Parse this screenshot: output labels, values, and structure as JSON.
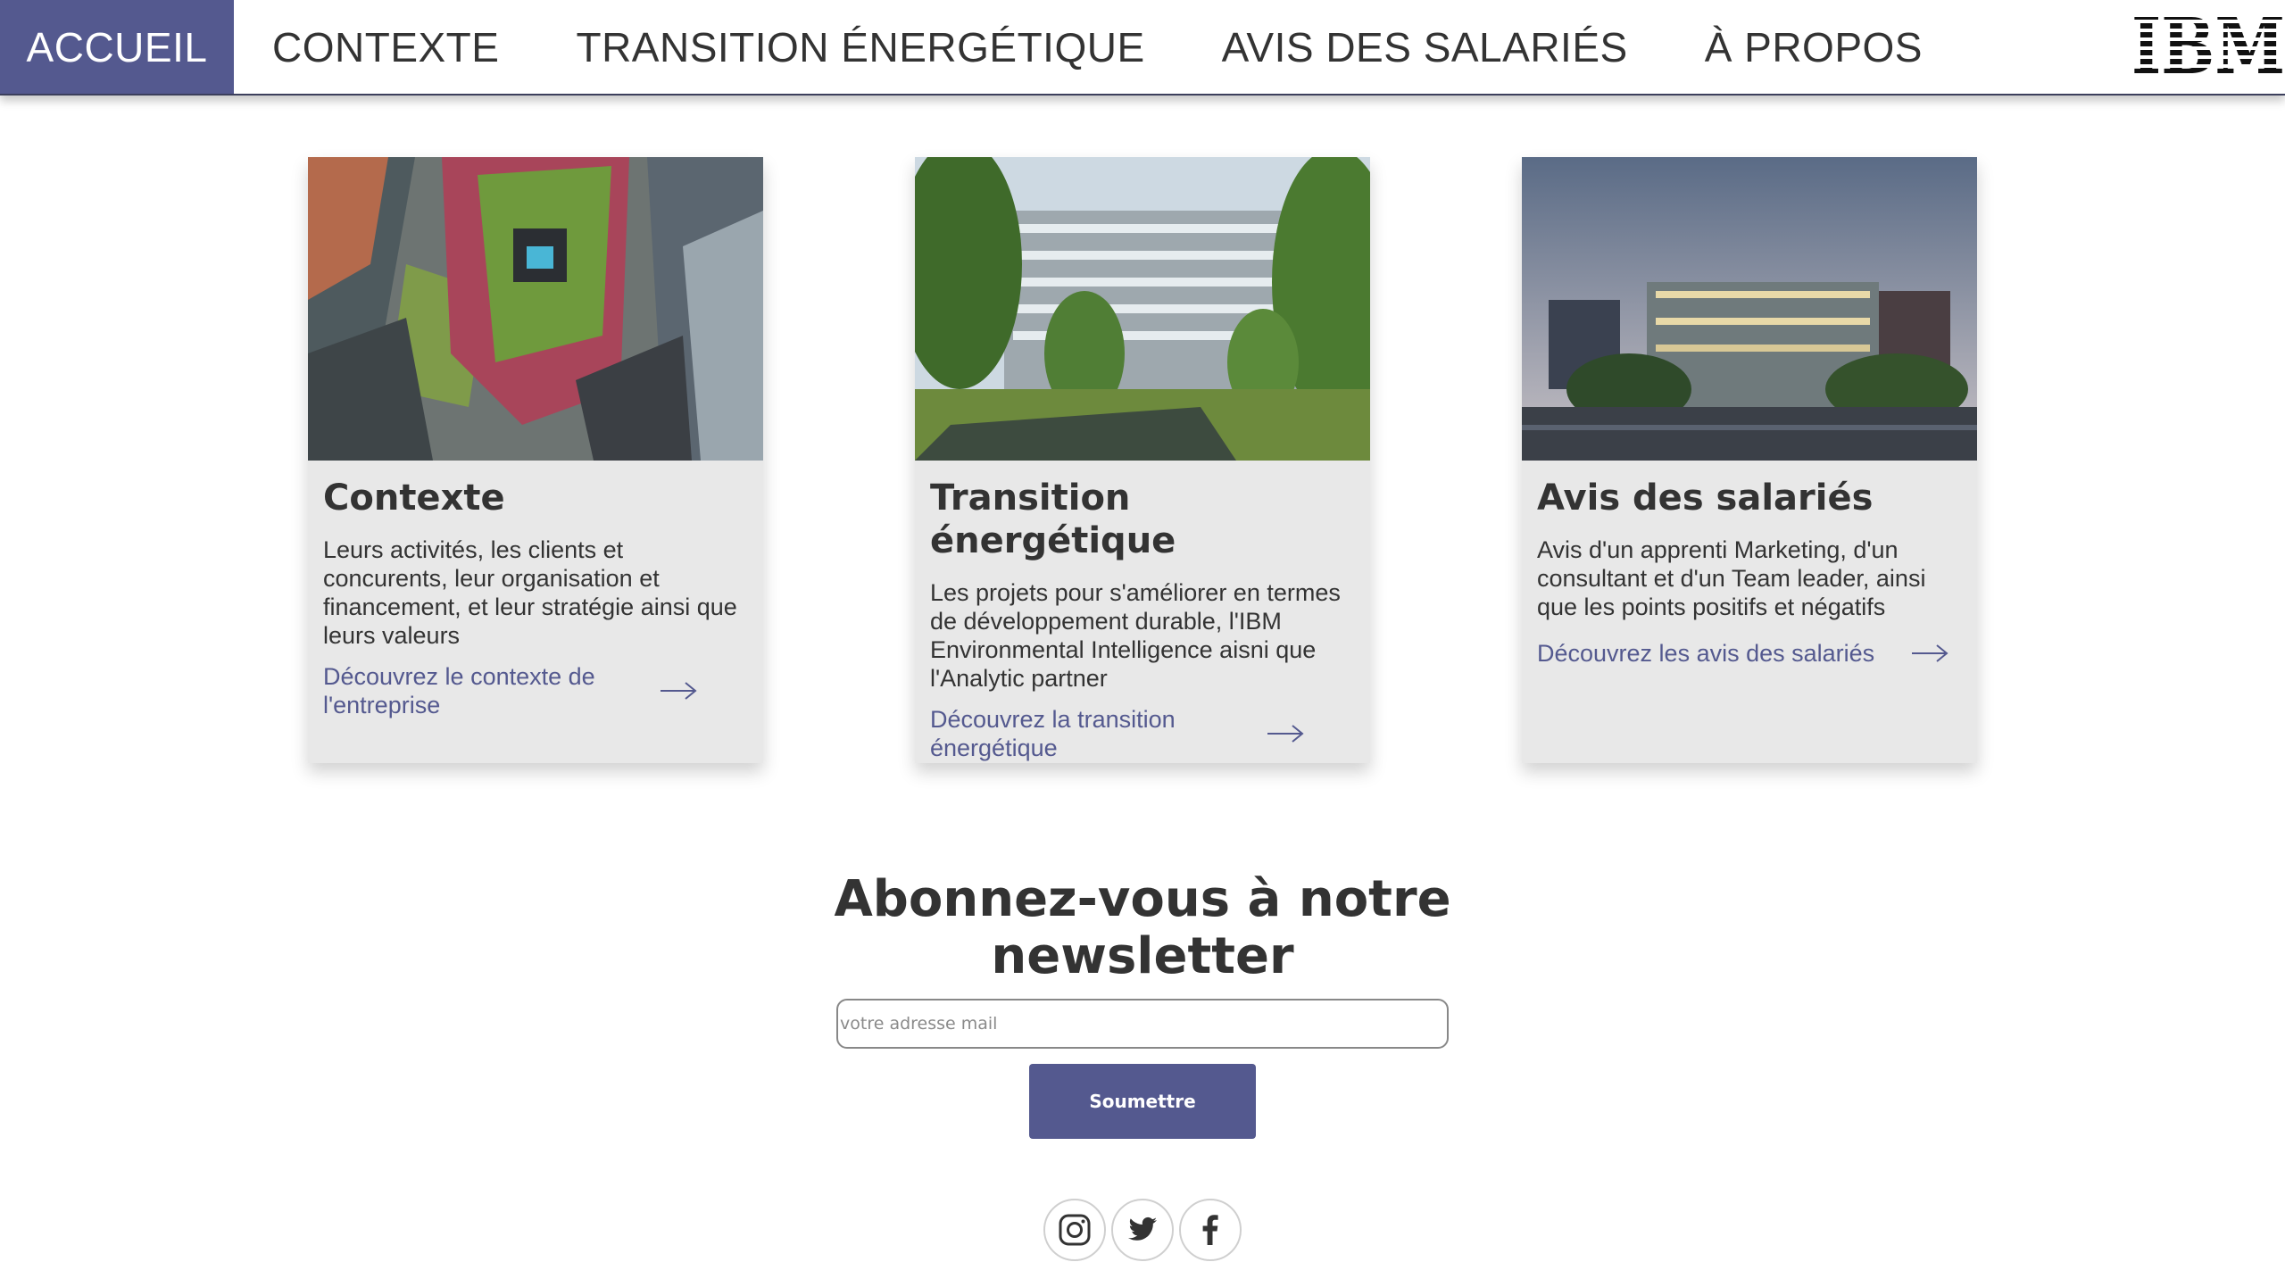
{
  "nav": {
    "items": [
      {
        "label": "ACCUEIL",
        "active": true
      },
      {
        "label": "CONTEXTE",
        "active": false
      },
      {
        "label": "TRANSITION ÉNERGÉTIQUE",
        "active": false
      },
      {
        "label": "AVIS DES SALARIÉS",
        "active": false
      },
      {
        "label": "À PROPOS",
        "active": false
      }
    ],
    "logo": "IBM"
  },
  "cards": [
    {
      "title": "Contexte",
      "text": "Leurs activités, les clients et concurents, leur organisation et financement, et leur stratégie ainsi que leurs valeurs",
      "link": "Découvrez le contexte de l'entreprise",
      "image": "aerial-green-tower-photo"
    },
    {
      "title": "Transition énergétique",
      "text": "Les projets pour s'améliorer en termes de développement durable, l'IBM Environmental Intelligence aisni que l'Analytic partner",
      "link": "Découvrez la transition énergétique",
      "image": "green-office-building-photo"
    },
    {
      "title": "Avis des salariés",
      "text": "Avis d'un apprenti Marketing, d'un consultant et d'un Team leader, ainsi que les points positifs et négatifs",
      "link": "Découvrez les avis des salariés",
      "image": "city-campus-photo"
    }
  ],
  "newsletter": {
    "title": "Abonnez-vous à notre newsletter",
    "placeholder": "votre adresse mail",
    "submit_label": "Soumettre"
  },
  "social": [
    "instagram-icon",
    "twitter-icon",
    "facebook-icon"
  ],
  "colors": {
    "accent": "#54598f",
    "card_bg": "#e8e8e8",
    "text": "#333333"
  }
}
